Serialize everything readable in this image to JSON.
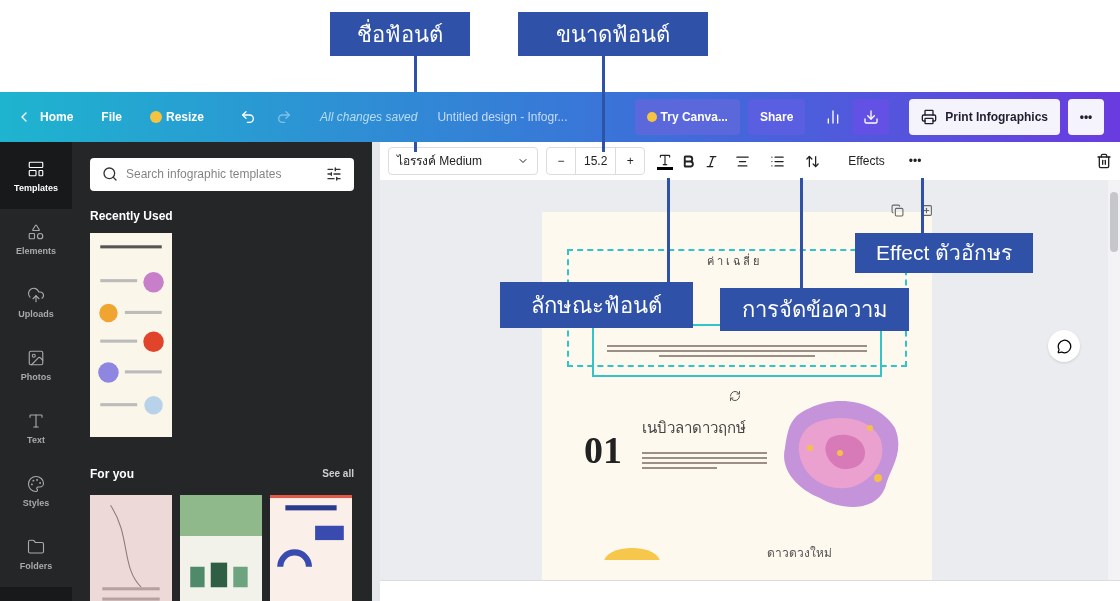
{
  "annotations": [
    {
      "label": "ชื่อฟ้อนต์"
    },
    {
      "label": "ขนาดฟ้อนต์"
    },
    {
      "label": "Effect ตัวอักษร"
    },
    {
      "label": "ลักษณะฟ้อนต์"
    },
    {
      "label": "การจัดข้อความ"
    }
  ],
  "topbar": {
    "home": "Home",
    "file": "File",
    "resize": "Resize",
    "status": "All changes saved",
    "title": "Untitled design - Infogr...",
    "try": "Try Canva...",
    "share": "Share",
    "print": "Print Infographics",
    "more": "•••"
  },
  "rail": [
    {
      "label": "Templates",
      "selected": true
    },
    {
      "label": "Elements",
      "selected": false
    },
    {
      "label": "Uploads",
      "selected": false
    },
    {
      "label": "Photos",
      "selected": false
    },
    {
      "label": "Text",
      "selected": false
    },
    {
      "label": "Styles",
      "selected": false
    },
    {
      "label": "Folders",
      "selected": false
    }
  ],
  "panel": {
    "search_placeholder": "Search infographic templates",
    "recent": "Recently Used",
    "for_you": "For you",
    "see_all": "See all"
  },
  "toolbar": {
    "font": "ไอรรงค์ Medium",
    "minus": "−",
    "size": "15.2",
    "plus": "+",
    "effects": "Effects",
    "more": "•••"
  },
  "page": {
    "subtitle": "ค่าเฉลี่ย",
    "number": "01",
    "heading": "เนบิวลาดาวฤกษ์",
    "next_heading": "ดาวดวงใหม่"
  }
}
